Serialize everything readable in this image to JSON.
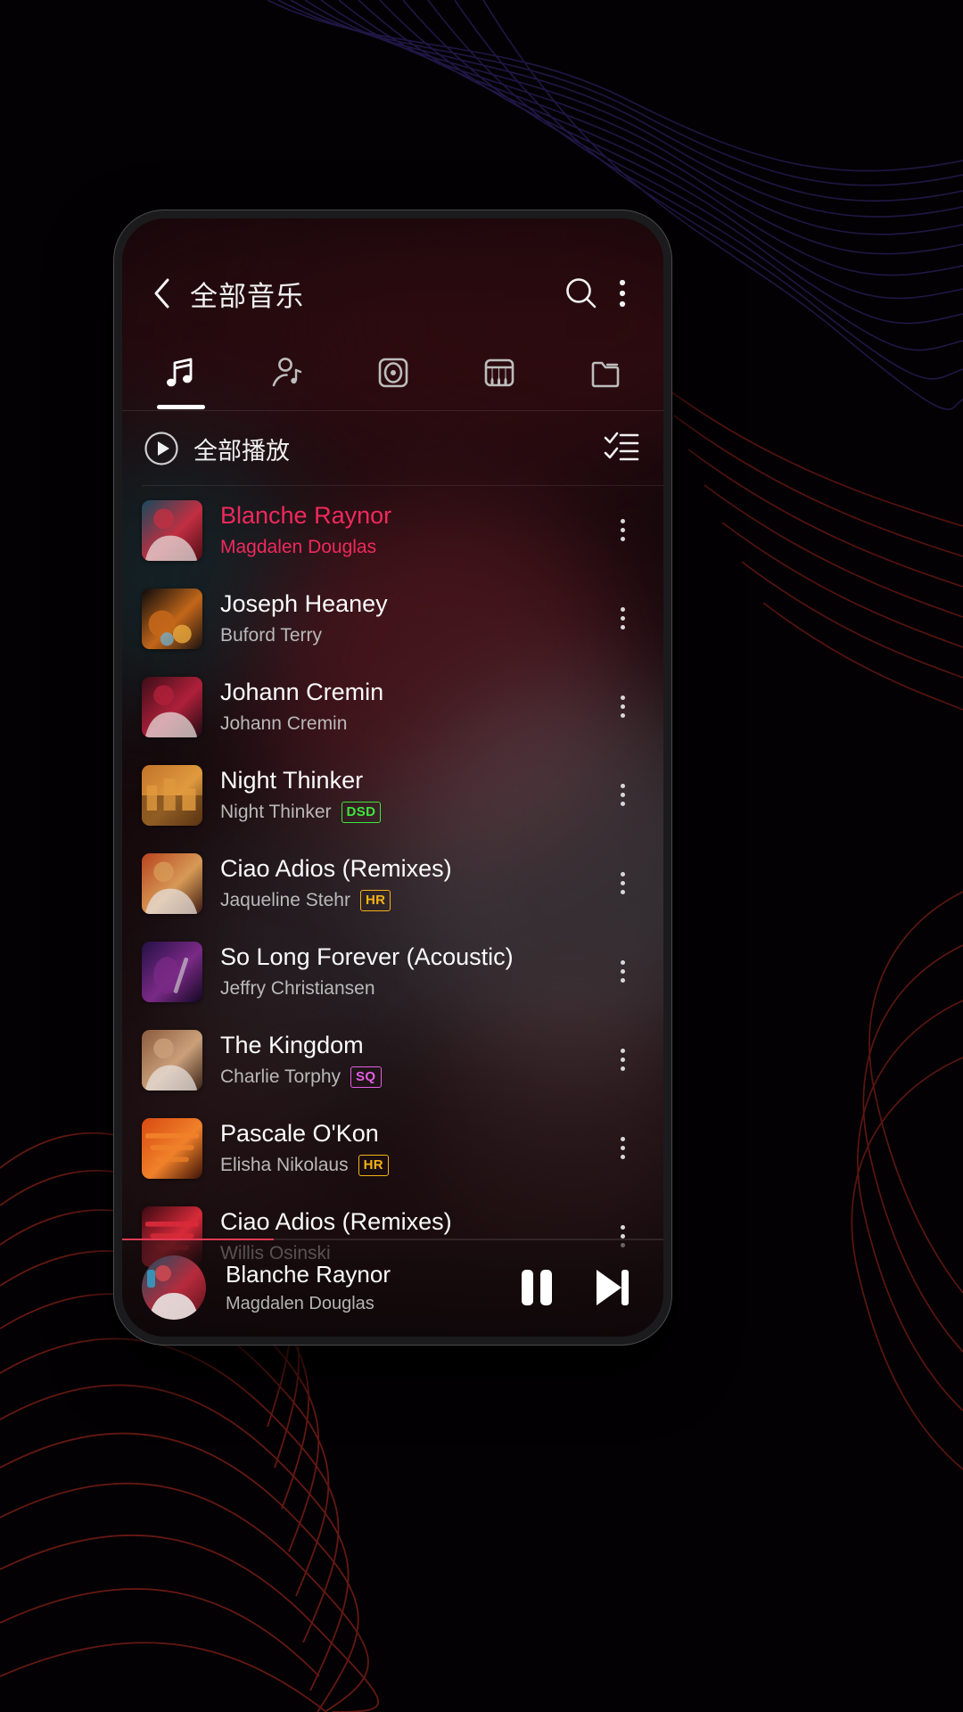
{
  "app": {
    "header": {
      "back_icon": "chevron-left-icon",
      "title": "全部音乐",
      "search_icon": "search-icon",
      "overflow_icon": "more-vertical-icon"
    },
    "tabs": [
      {
        "name": "songs",
        "icon": "music-note-icon",
        "active": true
      },
      {
        "name": "artists",
        "icon": "artist-icon",
        "active": false
      },
      {
        "name": "albums",
        "icon": "album-disc-icon",
        "active": false
      },
      {
        "name": "genres",
        "icon": "piano-keys-icon",
        "active": false
      },
      {
        "name": "folders",
        "icon": "folder-icon",
        "active": false
      }
    ],
    "play_all": {
      "icon": "play-circle-icon",
      "label": "全部播放",
      "multi_select_icon": "checklist-icon"
    },
    "tracks": [
      {
        "title": "Blanche Raynor",
        "artist": "Magdalen Douglas",
        "badge": "",
        "playing": true,
        "art": "a1"
      },
      {
        "title": "Joseph Heaney",
        "artist": "Buford Terry",
        "badge": "",
        "playing": false,
        "art": "a2"
      },
      {
        "title": "Johann Cremin",
        "artist": "Johann Cremin",
        "badge": "",
        "playing": false,
        "art": "a3"
      },
      {
        "title": "Night Thinker",
        "artist": "Night Thinker",
        "badge": "DSD",
        "playing": false,
        "art": "a4"
      },
      {
        "title": "Ciao Adios (Remixes)",
        "artist": "Jaqueline Stehr",
        "badge": "HR",
        "playing": false,
        "art": "a5"
      },
      {
        "title": "So Long Forever (Acoustic)",
        "artist": "Jeffry Christiansen",
        "badge": "",
        "playing": false,
        "art": "a6"
      },
      {
        "title": "The Kingdom",
        "artist": "Charlie Torphy",
        "badge": "SQ",
        "playing": false,
        "art": "a7"
      },
      {
        "title": "Pascale O'Kon",
        "artist": "Elisha Nikolaus",
        "badge": "HR",
        "playing": false,
        "art": "a8"
      },
      {
        "title": "Ciao Adios (Remixes)",
        "artist": "Willis Osinski",
        "badge": "",
        "playing": false,
        "art": "a9"
      }
    ],
    "now_playing": {
      "title": "Blanche Raynor",
      "artist": "Magdalen Douglas",
      "pause_icon": "pause-icon",
      "next_icon": "skip-next-icon",
      "progress_percent": 28
    },
    "colors": {
      "accent_pink": "#f0295b",
      "badge_dsd": "#3ce83c",
      "badge_hr": "#f5b316",
      "badge_sq": "#e45ee4",
      "text_primary": "#fbfbfb",
      "text_secondary": "#b9b9b9",
      "wallpaper": "#000000"
    }
  }
}
